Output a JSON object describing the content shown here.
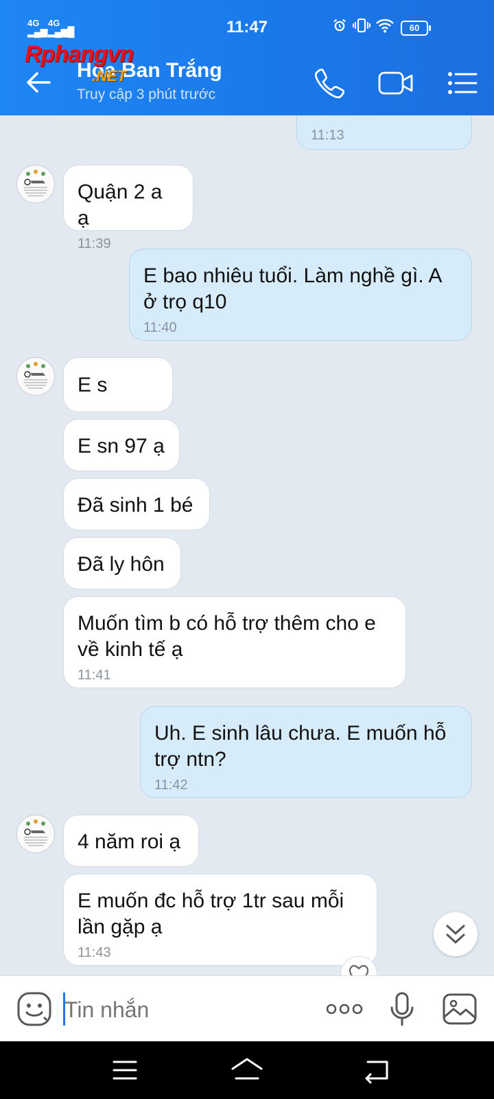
{
  "status": {
    "network1": "4G",
    "network2": "4G",
    "time": "11:47",
    "battery": "60"
  },
  "header": {
    "title": "Hoa Ban Trắng",
    "subtitle": "Truy cập 3 phút trước",
    "watermark": "Rphangvn",
    "watermark_suffix": ".NET",
    "icons": [
      "back-arrow-icon",
      "phone-icon",
      "video-call-icon",
      "menu-list-icon"
    ]
  },
  "messages": [
    {
      "dir": "out",
      "text": "",
      "time": "11:13",
      "partial": true
    },
    {
      "dir": "in",
      "text": "Quận 2 a ạ",
      "time": "11:39"
    },
    {
      "dir": "out",
      "text": "E bao nhiêu tuổi. Làm nghề gì. A ở trọ q10",
      "time": "11:40"
    },
    {
      "dir": "in",
      "text": "E s",
      "time": ""
    },
    {
      "dir": "in",
      "text": "E sn 97 ạ",
      "time": ""
    },
    {
      "dir": "in",
      "text": "Đã sinh 1 bé",
      "time": ""
    },
    {
      "dir": "in",
      "text": "Đã ly hôn",
      "time": ""
    },
    {
      "dir": "in",
      "text": "Muốn tìm b có hỗ trợ thêm cho e về kinh tế ạ",
      "time": "11:41"
    },
    {
      "dir": "out",
      "text": "Uh. E sinh lâu chưa. E muốn hỗ trợ ntn?",
      "time": "11:42"
    },
    {
      "dir": "in",
      "text": "4 năm roi ạ",
      "time": ""
    },
    {
      "dir": "in",
      "text": "E muốn đc hỗ trợ 1tr sau mỗi lần gặp ạ",
      "time": "11:43"
    }
  ],
  "input": {
    "placeholder": "Tin nhắn"
  },
  "colors": {
    "header": "#1a79ea",
    "outgoing_bubble": "#d6ecfb",
    "incoming_bubble": "#ffffff",
    "chat_bg": "#e2e9f1"
  }
}
